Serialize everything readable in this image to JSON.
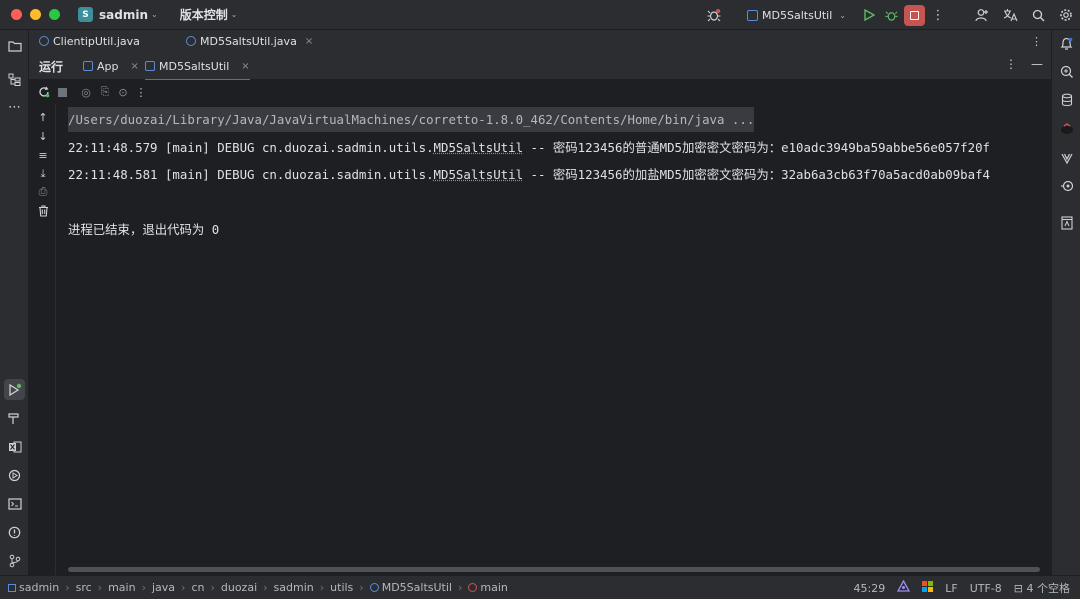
{
  "titlebar": {
    "project_initial": "S",
    "project_name": "sadmin",
    "vcs_label": "版本控制",
    "run_config": "MD5SaltsUtil",
    "colors": {
      "close": "#ff5f57",
      "minimize": "#febc2e",
      "maximize": "#28c840",
      "stop": "#c75450",
      "run": "#5fb865",
      "debug": "#5fb865"
    }
  },
  "editor_tabs": [
    {
      "label": "ClientipUtil.java"
    },
    {
      "label": "MD5SaltsUtil.java",
      "close": "×"
    }
  ],
  "run_panel": {
    "title": "运行",
    "tabs": [
      {
        "label": "App",
        "close": "×"
      },
      {
        "label": "MD5SaltsUtil",
        "close": "×"
      }
    ]
  },
  "console": {
    "lines": {
      "command": "/Users/duozai/Library/Java/JavaVirtualMachines/corretto-1.8.0_462/Contents/Home/bin/java ...",
      "log1": {
        "prefix": "22:11:48.579 [main] DEBUG cn.duozai.sadmin.utils.",
        "cls": "MD5SaltsUtil",
        "msg": " -- 密码123456的普通MD5加密密文密码为：e10adc3949ba59abbe56e057f20f"
      },
      "log2": {
        "prefix": "22:11:48.581 [main] DEBUG cn.duozai.sadmin.utils.",
        "cls": "MD5SaltsUtil",
        "msg": " -- 密码123456的加盐MD5加密密文密码为：32ab6a3cb63f70a5acd0ab09baf4"
      },
      "exit": "进程已结束，退出代码为 0"
    }
  },
  "statusbar": {
    "breadcrumbs": [
      "sadmin",
      "src",
      "main",
      "java",
      "cn",
      "duozai",
      "sadmin",
      "utils",
      "MD5SaltsUtil",
      "main"
    ],
    "position": "45:29",
    "line_ending": "LF",
    "encoding": "UTF-8",
    "indent": "4 个空格"
  }
}
